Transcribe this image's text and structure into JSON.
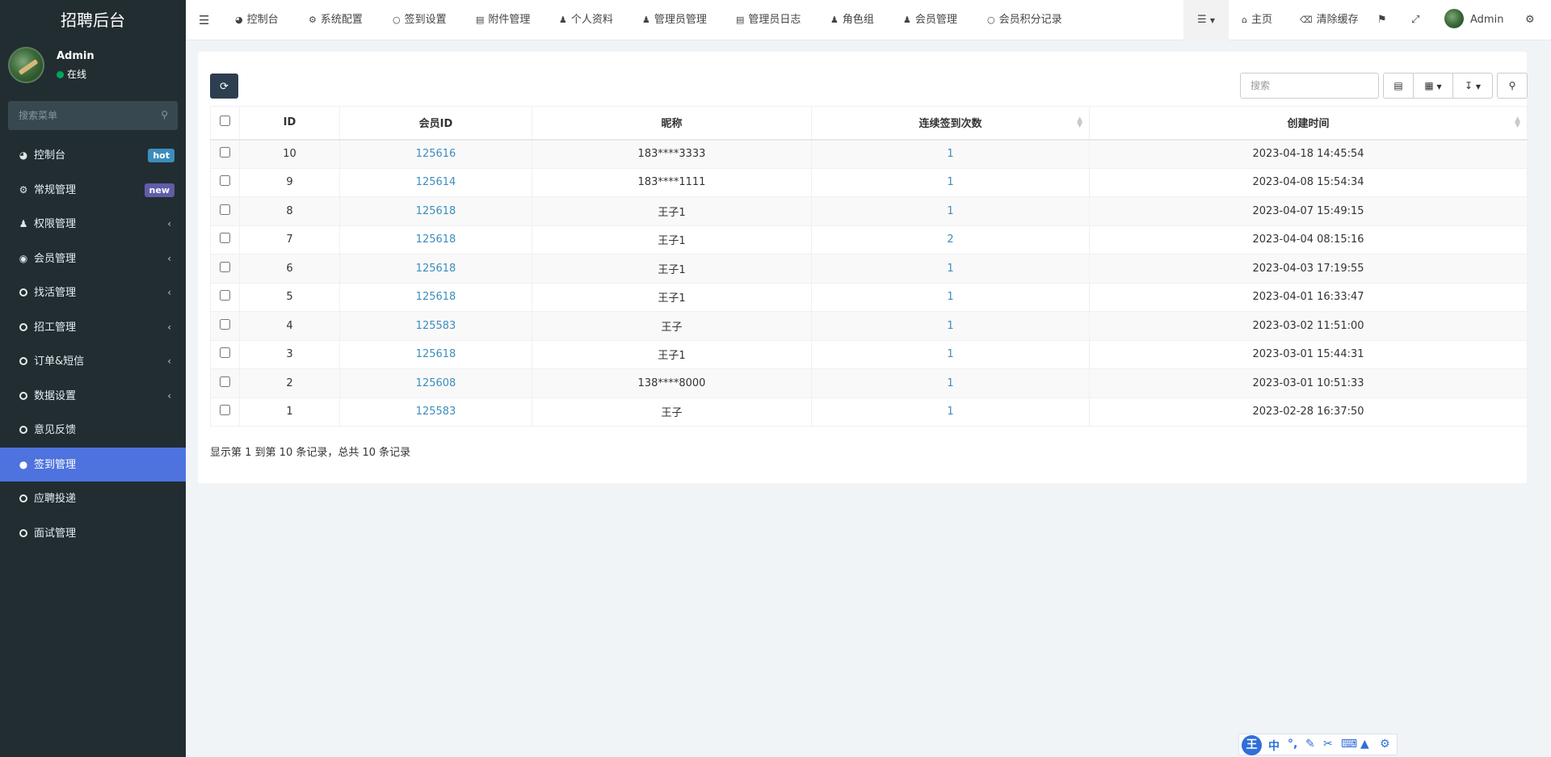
{
  "brand": {
    "title": "招聘后台"
  },
  "user": {
    "name": "Admin",
    "status": "在线"
  },
  "sidebar_search": {
    "placeholder": "搜索菜单"
  },
  "sidebar": {
    "items": [
      {
        "label": "控制台",
        "icon": "dashboard-icon",
        "badge": "hot"
      },
      {
        "label": "常规管理",
        "icon": "cogs-icon",
        "badge": "new"
      },
      {
        "label": "权限管理",
        "icon": "users-icon"
      },
      {
        "label": "会员管理",
        "icon": "user-circle-icon"
      },
      {
        "label": "找活管理",
        "icon": "circle-icon"
      },
      {
        "label": "招工管理",
        "icon": "circle-icon"
      },
      {
        "label": "订单&短信",
        "icon": "circle-icon"
      },
      {
        "label": "数据设置",
        "icon": "circle-icon"
      },
      {
        "label": "意见反馈",
        "icon": "circle-icon"
      },
      {
        "label": "签到管理",
        "icon": "map-marker-icon",
        "active": true
      },
      {
        "label": "应聘投递",
        "icon": "circle-icon"
      },
      {
        "label": "面试管理",
        "icon": "circle-icon"
      }
    ]
  },
  "topnav": {
    "tabs": [
      {
        "label": "控制台",
        "icon": "dashboard-icon"
      },
      {
        "label": "系统配置",
        "icon": "cog-icon"
      },
      {
        "label": "签到设置",
        "icon": "circle-icon"
      },
      {
        "label": "附件管理",
        "icon": "file-image-icon"
      },
      {
        "label": "个人资料",
        "icon": "user-icon"
      },
      {
        "label": "管理员管理",
        "icon": "user-icon"
      },
      {
        "label": "管理员日志",
        "icon": "list-alt-icon"
      },
      {
        "label": "角色组",
        "icon": "group-icon"
      },
      {
        "label": "会员管理",
        "icon": "user-icon"
      },
      {
        "label": "会员积分记录",
        "icon": "circle-icon"
      }
    ],
    "home_label": "主页",
    "clear_cache_label": "清除缓存",
    "admin_label": "Admin"
  },
  "toolbar": {
    "search_placeholder": "搜索"
  },
  "table": {
    "columns": [
      "ID",
      "会员ID",
      "昵称",
      "连续签到次数",
      "创建时间"
    ],
    "rows": [
      {
        "id": "10",
        "member_id": "125616",
        "nickname": "183****3333",
        "days": "1",
        "created": "2023-04-18 14:45:54"
      },
      {
        "id": "9",
        "member_id": "125614",
        "nickname": "183****1111",
        "days": "1",
        "created": "2023-04-08 15:54:34"
      },
      {
        "id": "8",
        "member_id": "125618",
        "nickname": "王子1",
        "days": "1",
        "created": "2023-04-07 15:49:15"
      },
      {
        "id": "7",
        "member_id": "125618",
        "nickname": "王子1",
        "days": "2",
        "created": "2023-04-04 08:15:16"
      },
      {
        "id": "6",
        "member_id": "125618",
        "nickname": "王子1",
        "days": "1",
        "created": "2023-04-03 17:19:55"
      },
      {
        "id": "5",
        "member_id": "125618",
        "nickname": "王子1",
        "days": "1",
        "created": "2023-04-01 16:33:47"
      },
      {
        "id": "4",
        "member_id": "125583",
        "nickname": "王子",
        "days": "1",
        "created": "2023-03-02 11:51:00"
      },
      {
        "id": "3",
        "member_id": "125618",
        "nickname": "王子1",
        "days": "1",
        "created": "2023-03-01 15:44:31"
      },
      {
        "id": "2",
        "member_id": "125608",
        "nickname": "138****8000",
        "days": "1",
        "created": "2023-03-01 10:51:33"
      },
      {
        "id": "1",
        "member_id": "125583",
        "nickname": "王子",
        "days": "1",
        "created": "2023-02-28 16:37:50"
      }
    ]
  },
  "pagination": {
    "info": "显示第 1 到第 10 条记录，总共 10 条记录"
  },
  "ime": {
    "logo": "王",
    "mode": "中"
  },
  "colors": {
    "sidebar_bg": "#222d32",
    "active": "#4e73df",
    "link": "#3c8dbc",
    "badge_hot": "#3c8dbc",
    "badge_new": "#605ca8",
    "refresh_btn": "#2c3e50"
  }
}
